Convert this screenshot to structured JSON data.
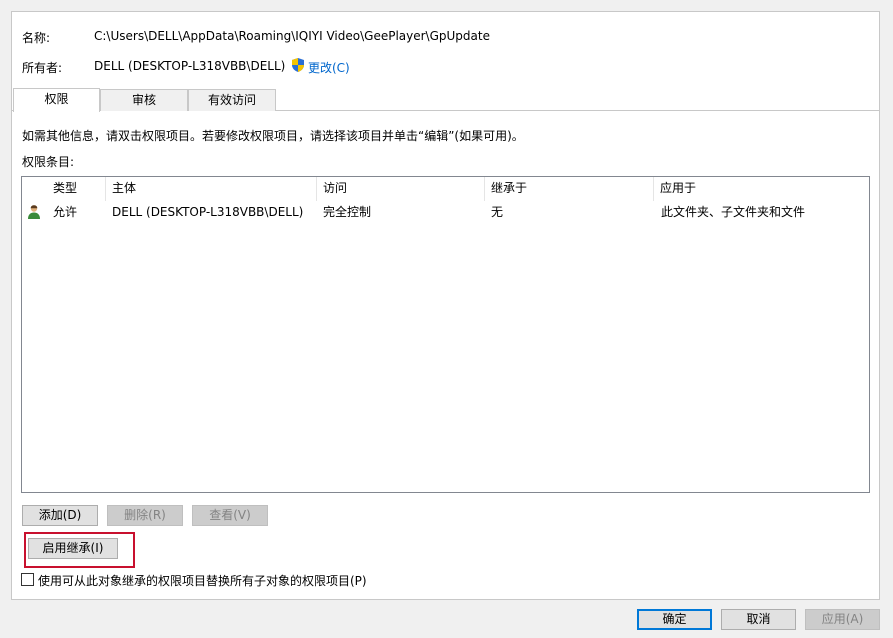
{
  "owner_section": {
    "name_label": "名称:",
    "name_value": "C:\\Users\\DELL\\AppData\\Roaming\\IQIYI Video\\GeePlayer\\GpUpdate",
    "owner_label": "所有者:",
    "owner_value": "DELL (DESKTOP-L318VBB\\DELL)",
    "change_link": "更改(C)"
  },
  "tabs": [
    {
      "label": "权限",
      "active": true
    },
    {
      "label": "审核",
      "active": false
    },
    {
      "label": "有效访问",
      "active": false
    }
  ],
  "info_text": "如需其他信息，请双击权限项目。若要修改权限项目，请选择该项目并单击“编辑”(如果可用)。",
  "entries_label": "权限条目:",
  "table": {
    "headers": [
      "类型",
      "主体",
      "访问",
      "继承于",
      "应用于"
    ],
    "rows": [
      {
        "type": "允许",
        "principal": "DELL (DESKTOP-L318VBB\\DELL)",
        "access": "完全控制",
        "inherited_from": "无",
        "applies_to": "此文件夹、子文件夹和文件"
      }
    ]
  },
  "buttons": {
    "add": "添加(D)",
    "remove": "删除(R)",
    "view": "查看(V)",
    "enable_inheritance": "启用继承(I)"
  },
  "replace_checkbox_label": "使用可从此对象继承的权限项目替换所有子对象的权限项目(P)",
  "footer": {
    "ok": "确定",
    "cancel": "取消",
    "apply": "应用(A)"
  },
  "colors": {
    "highlight": "#c8102e",
    "link": "#0066cc"
  }
}
